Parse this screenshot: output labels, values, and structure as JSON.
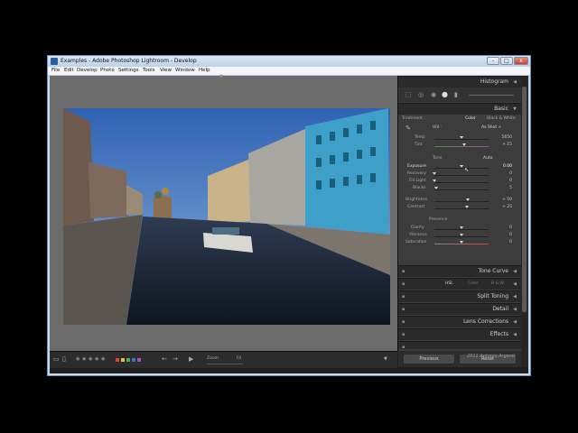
{
  "window": {
    "title": "Examples - Adobe Photoshop Lightroom - Develop",
    "min": "-",
    "max": "□",
    "close": "x"
  },
  "menu": [
    "File",
    "Edit",
    "Develop",
    "Photo",
    "Settings",
    "Tools",
    "View",
    "Window",
    "Help"
  ],
  "panel": {
    "histogram": "Histogram",
    "basic": {
      "title": "Basic",
      "treatment_label": "Treatment :",
      "treatment_color": "Color",
      "treatment_bw": "Black & White",
      "wb_label": "WB :",
      "wb_value": "As Shot ÷",
      "temp_label": "Temp",
      "temp_value": "5650",
      "tint_label": "Tint",
      "tint_value": "+ 15",
      "tone_label": "Tone",
      "tone_auto": "Auto",
      "exposure_label": "Exposure",
      "exposure_value": "0.00",
      "recovery_label": "Recovery",
      "recovery_value": "0",
      "filllight_label": "Fill Light",
      "filllight_value": "0",
      "blacks_label": "Blacks",
      "blacks_value": "5",
      "brightness_label": "Brightness",
      "brightness_value": "+ 50",
      "contrast_label": "Contrast",
      "contrast_value": "+ 25",
      "presence_label": "Presence",
      "clarity_label": "Clarity",
      "clarity_value": "0",
      "vibrance_label": "Vibrance",
      "vibrance_value": "0",
      "saturation_label": "Saturation",
      "saturation_value": "0"
    },
    "tone_curve": "Tone Curve",
    "hsl": "HSL",
    "color": "Color",
    "bw": "B & W",
    "split_toning": "Split Toning",
    "detail": "Detail",
    "lens_corrections": "Lens Corrections",
    "effects": "Effects",
    "previous": "Previous",
    "reset": "Reset"
  },
  "sliders": {
    "temp": 0.5,
    "tint": 0.55,
    "exposure": 0.5,
    "recovery": 0.0,
    "filllight": 0.0,
    "blacks": 0.04,
    "brightness": 0.62,
    "contrast": 0.6,
    "clarity": 0.5,
    "vibrance": 0.5,
    "saturation": 0.5
  },
  "filmstrip": {
    "stars": [
      "★",
      "★",
      "★",
      "★",
      "★"
    ],
    "labels": [
      "#e04040",
      "#e0c040",
      "#50b050",
      "#4070d0",
      "#a050c0"
    ],
    "zoom_label": "Zoom",
    "zoom_value": "Fit"
  },
  "watermark": "2011 Antonio Argenti"
}
